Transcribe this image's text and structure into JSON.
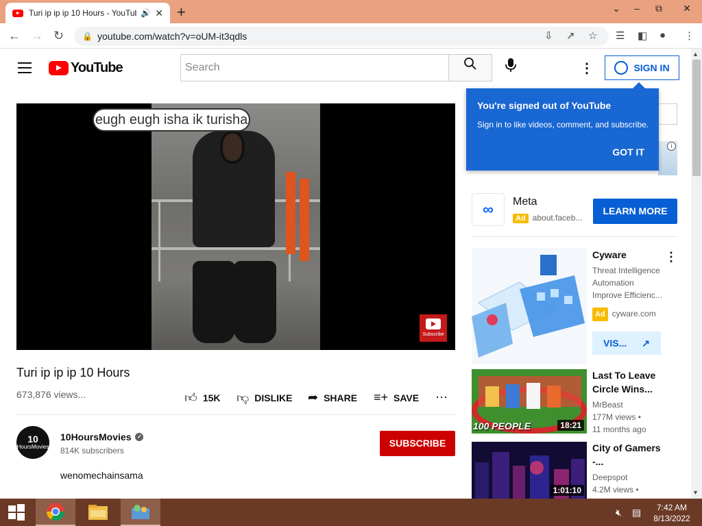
{
  "browser": {
    "tab_title": "Turi ip ip ip 10 Hours - YouTube",
    "new_tab": "+",
    "url": "youtube.com/watch?v=oUM-it3qdls"
  },
  "youtube": {
    "logo_text": "YouTube",
    "search_placeholder": "Search",
    "sign_in": "SIGN IN"
  },
  "video": {
    "overlay_caption": "eugh eugh isha ik turisha",
    "watermark": "Subscribe",
    "title": "Turi ip ip ip 10 Hours",
    "views": "673,876 views...",
    "likes": "15K",
    "dislike": "DISLIKE",
    "share": "SHARE",
    "save": "SAVE"
  },
  "channel": {
    "avatar_text_top": "10",
    "avatar_text_bottom": "HoursMovies",
    "name": "10HoursMovies",
    "subscribers": "814K subscribers",
    "subscribe": "SUBSCRIBE",
    "description": "wenomechainsama"
  },
  "popup": {
    "heading": "You're signed out of YouTube",
    "text": "Sign in to like videos, comment, and subscribe.",
    "button": "GOT IT"
  },
  "ad": {
    "advertiser": "Meta",
    "badge": "Ad",
    "url": "about.faceb...",
    "cta": "LEARN MORE"
  },
  "recommendations": [
    {
      "title": "Cyware",
      "lines": [
        "Threat Intelligence",
        "Automation",
        "Improve Efficienc..."
      ],
      "badge": "Ad",
      "url": "cyware.com",
      "cta": "VIS..."
    },
    {
      "title_1": "Last To Leave",
      "title_2": "Circle Wins...",
      "channel": "MrBeast",
      "views": "177M views •",
      "age": "11 months ago",
      "duration": "18:21",
      "thumb_text": "100 PEOPLE"
    },
    {
      "title_1": "City of Gamers",
      "title_2": "-...",
      "channel": "Deepspot",
      "views": "4.2M views •",
      "duration": "1:01:10"
    }
  ],
  "taskbar": {
    "time": "7:42 AM",
    "date": "8/13/2022"
  },
  "colors": {
    "titlebar": "#e9a17f",
    "youtube_red": "#ff0000",
    "subscribe_red": "#cc0000",
    "popup_blue": "#1967d2",
    "link_blue": "#065fd4",
    "taskbar": "#6b3a26"
  }
}
